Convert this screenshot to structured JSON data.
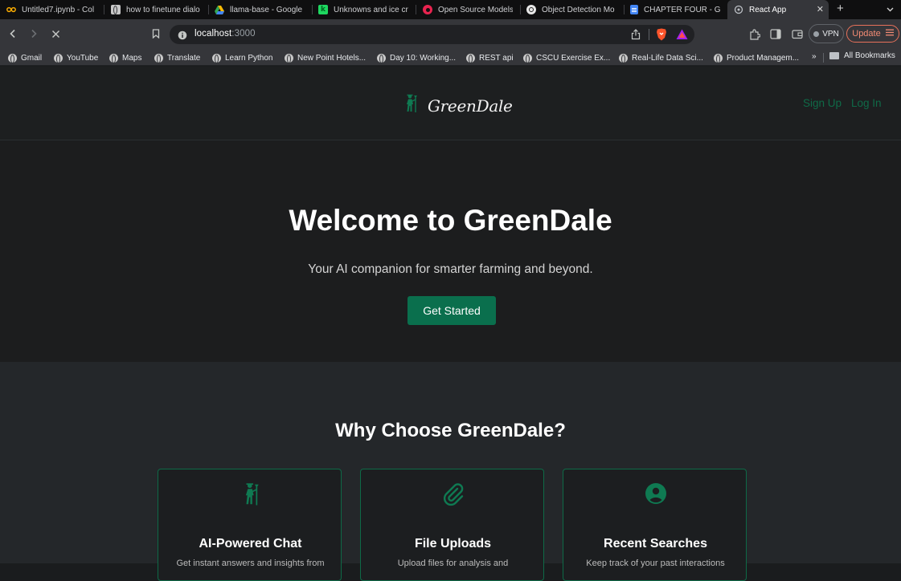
{
  "browser": {
    "tabs": [
      {
        "title": "Untitled7.ipynb - Col",
        "icon": "colab-icon"
      },
      {
        "title": "how to finetune dialo",
        "icon": "globe-icon"
      },
      {
        "title": "llama-base - Google",
        "icon": "google-drive-icon"
      },
      {
        "title": "Unknowns and ice cr",
        "icon": "green-k-icon"
      },
      {
        "title": "Open Source Models",
        "icon": "red-circle-icon"
      },
      {
        "title": "Object Detection Mo",
        "icon": "openai-icon"
      },
      {
        "title": "CHAPTER FOUR - Gc",
        "icon": "google-docs-icon"
      },
      {
        "title": "React App",
        "icon": "react-icon",
        "active": true
      }
    ],
    "address": {
      "host": "localhost",
      "port": ":3000"
    },
    "vpn_label": "VPN",
    "update_label": "Update",
    "bookmarks": [
      "Gmail",
      "YouTube",
      "Maps",
      "Translate",
      "Learn Python",
      "New Point Hotels...",
      "Day 10: Working...",
      "REST api",
      "CSCU Exercise Ex...",
      "Real-Life Data Sci...",
      "Product Managem..."
    ],
    "bookmarks_more": "»",
    "all_bookmarks_label": "All Bookmarks"
  },
  "site": {
    "brand": "GreenDale",
    "nav": {
      "signup": "Sign Up",
      "login": "Log In"
    },
    "hero": {
      "title": "Welcome to GreenDale",
      "subtitle": "Your AI companion for smarter farming and beyond.",
      "cta": "Get Started"
    },
    "features": {
      "title": "Why Choose GreenDale?",
      "cards": [
        {
          "icon": "farmer-icon",
          "title": "AI-Powered Chat",
          "desc": "Get instant answers and insights from"
        },
        {
          "icon": "paperclip-icon",
          "title": "File Uploads",
          "desc": "Upload files for analysis and"
        },
        {
          "icon": "user-circle-icon",
          "title": "Recent Searches",
          "desc": "Keep track of your past interactions"
        }
      ]
    }
  },
  "colors": {
    "accent": "#0a6f4d",
    "nav_link": "#0f6b48",
    "card_border": "#0e6a47",
    "background": "#1c1d1e"
  }
}
